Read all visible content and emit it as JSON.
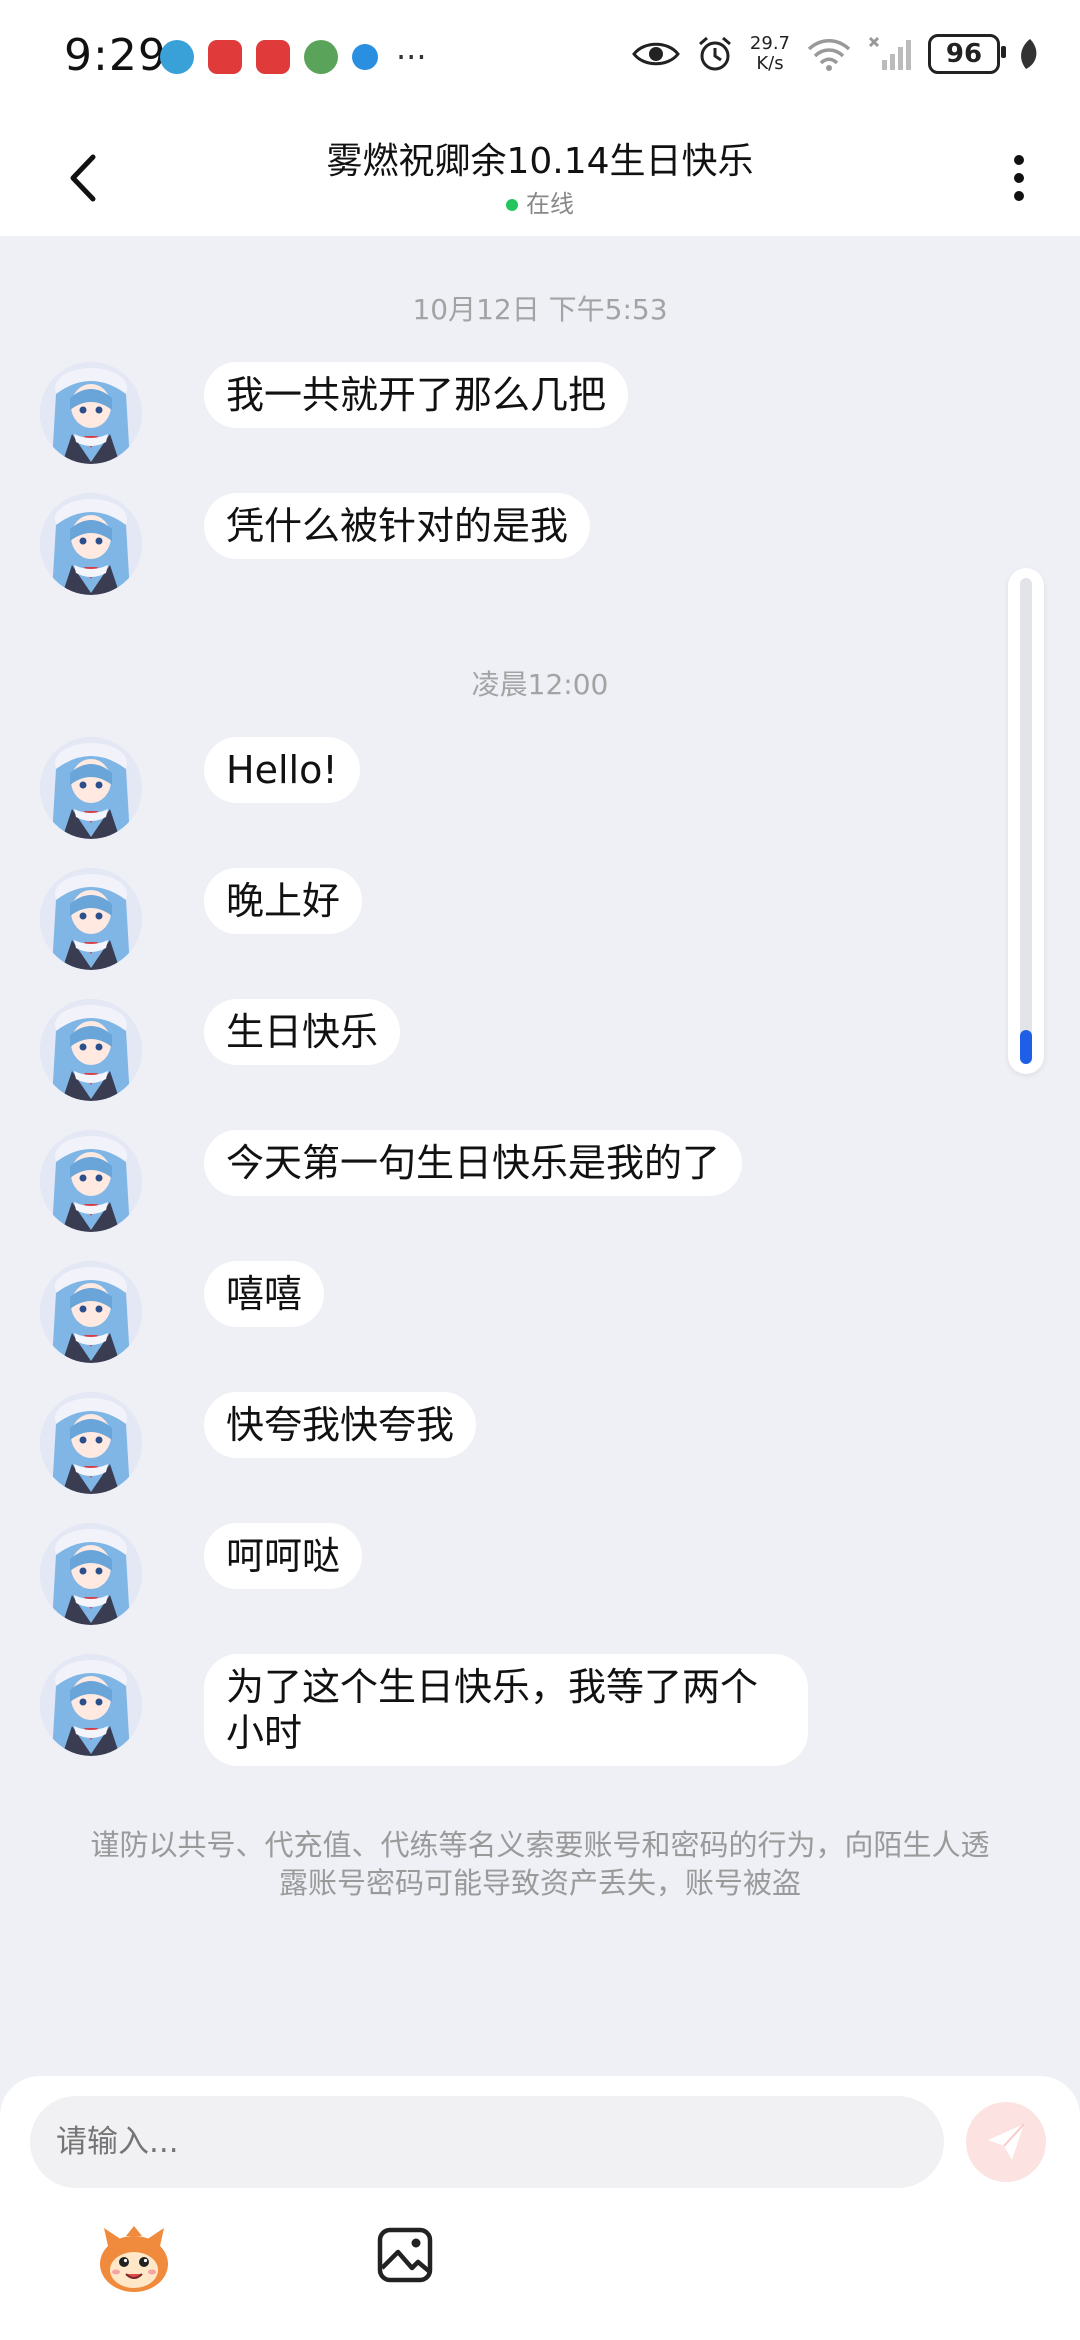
{
  "status_bar": {
    "time": "9:29",
    "network_speed_value": "29.7",
    "network_speed_unit": "K/s",
    "battery": "96",
    "app_icons": [
      "network-icon",
      "huawei-app-icon",
      "huawei-app-icon",
      "globe-app-icon",
      "browser-app-icon"
    ],
    "more": "···"
  },
  "header": {
    "title": "雾燃祝卿余10.14生日快乐",
    "status": "在线"
  },
  "chat": {
    "groups": [
      {
        "timestamp": "10月12日 下午5:53",
        "messages": [
          "我一共就开了那么几把",
          "凭什么被针对的是我"
        ]
      },
      {
        "timestamp": "凌晨12:00",
        "messages": [
          "Hello!",
          "晚上好",
          "生日快乐",
          "今天第一句生日快乐是我的了",
          "嘻嘻",
          "快夸我快夸我",
          "呵呵哒",
          "为了这个生日快乐，我等了两个小时"
        ]
      }
    ],
    "scroll_position": 1.0
  },
  "warning": "谨防以共号、代充值、代练等名义索要账号和密码的行为，向陌生人透露账号密码可能导致资产丢失，账号被盗",
  "input": {
    "placeholder": "请输入..."
  },
  "colors": {
    "background": "#eef0f6",
    "bubble": "#ffffff",
    "online_dot": "#22c55e",
    "scroll_thumb": "#1f5ee6",
    "send_button": "#fde2e2"
  }
}
